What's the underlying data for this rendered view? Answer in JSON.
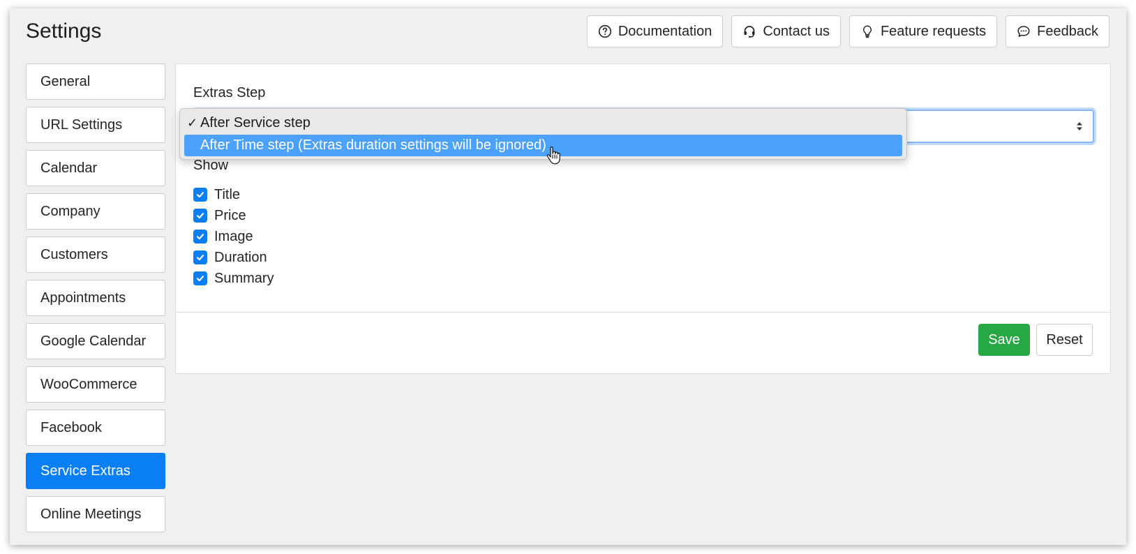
{
  "header": {
    "title": "Settings",
    "buttons": [
      {
        "label": "Documentation",
        "icon": "question-circle-icon"
      },
      {
        "label": "Contact us",
        "icon": "headset-icon"
      },
      {
        "label": "Feature requests",
        "icon": "lightbulb-icon"
      },
      {
        "label": "Feedback",
        "icon": "chat-bubble-icon"
      }
    ]
  },
  "sidebar": {
    "active_item": "Service Extras",
    "items": [
      {
        "label": "General"
      },
      {
        "label": "URL Settings"
      },
      {
        "label": "Calendar"
      },
      {
        "label": "Company"
      },
      {
        "label": "Customers"
      },
      {
        "label": "Appointments"
      },
      {
        "label": "Google Calendar"
      },
      {
        "label": "WooCommerce"
      },
      {
        "label": "Facebook"
      },
      {
        "label": "Service Extras"
      },
      {
        "label": "Online Meetings"
      }
    ]
  },
  "main": {
    "extras_step_label": "Extras Step",
    "extras_step_select": {
      "selected": "After Service step",
      "options": [
        {
          "label": "After Service step",
          "checkmark": "✓"
        },
        {
          "label": "After Time step (Extras duration settings will be ignored)"
        }
      ]
    },
    "show_label": "Show",
    "show_options": [
      {
        "label": "Title",
        "checked": true
      },
      {
        "label": "Price",
        "checked": true
      },
      {
        "label": "Image",
        "checked": true
      },
      {
        "label": "Duration",
        "checked": true
      },
      {
        "label": "Summary",
        "checked": true
      }
    ],
    "save_label": "Save",
    "reset_label": "Reset"
  },
  "colors": {
    "accent": "#0a7ff5",
    "save": "#28a745",
    "highlight": "#4ba1fc"
  }
}
